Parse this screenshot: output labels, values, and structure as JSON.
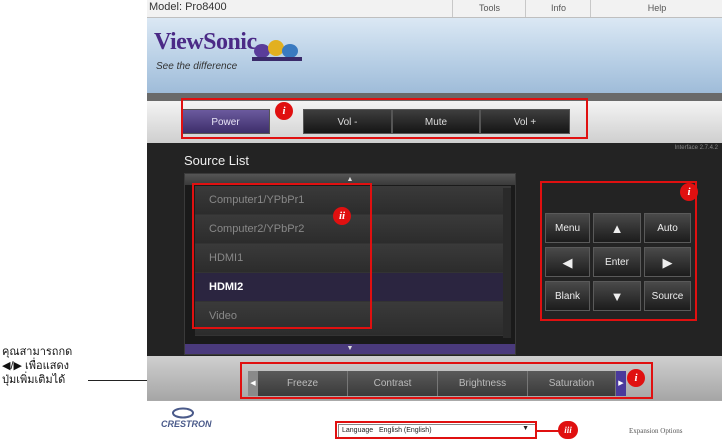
{
  "window": {
    "model": "Model: Pro8400",
    "menu": [
      "Tools",
      "Info",
      "Help"
    ],
    "interface": "Interface 2.7.4.2"
  },
  "brand": {
    "name": "ViewSonic",
    "tagline": "See the difference"
  },
  "power_bar": {
    "power": "Power",
    "vol_down": "Vol -",
    "mute": "Mute",
    "vol_up": "Vol +"
  },
  "source_list": {
    "title": "Source List",
    "scroll_up": "▲",
    "scroll_down": "▼",
    "items": [
      "Computer1/YPbPr1",
      "Computer2/YPbPr2",
      "HDMI1",
      "HDMI2",
      "Video"
    ],
    "selected": "HDMI2"
  },
  "controls": {
    "menu": "Menu",
    "up": "▲",
    "auto": "Auto",
    "left": "◀",
    "enter": "Enter",
    "right": "▶",
    "blank": "Blank",
    "down": "▼",
    "source": "Source"
  },
  "sliders": {
    "left": "◀",
    "right": "▶",
    "items": [
      "Freeze",
      "Contrast",
      "Brightness",
      "Saturation"
    ]
  },
  "footer": {
    "logo": "CRESTRON",
    "language_label": "Language",
    "language_value": "English (English)",
    "expansion": "Expansion Options"
  },
  "annotations": {
    "badge_i": "i",
    "badge_ii": "ii",
    "badge_iii": "iii",
    "note_line1": "คุณสามารถกด",
    "note_line2": "◀/▶ เพื่อแสดง",
    "note_line3": "ปุ่มเพิ่มเติมได้"
  },
  "colors": {
    "annotation": "#e01010",
    "accent": "#4b2a86"
  }
}
